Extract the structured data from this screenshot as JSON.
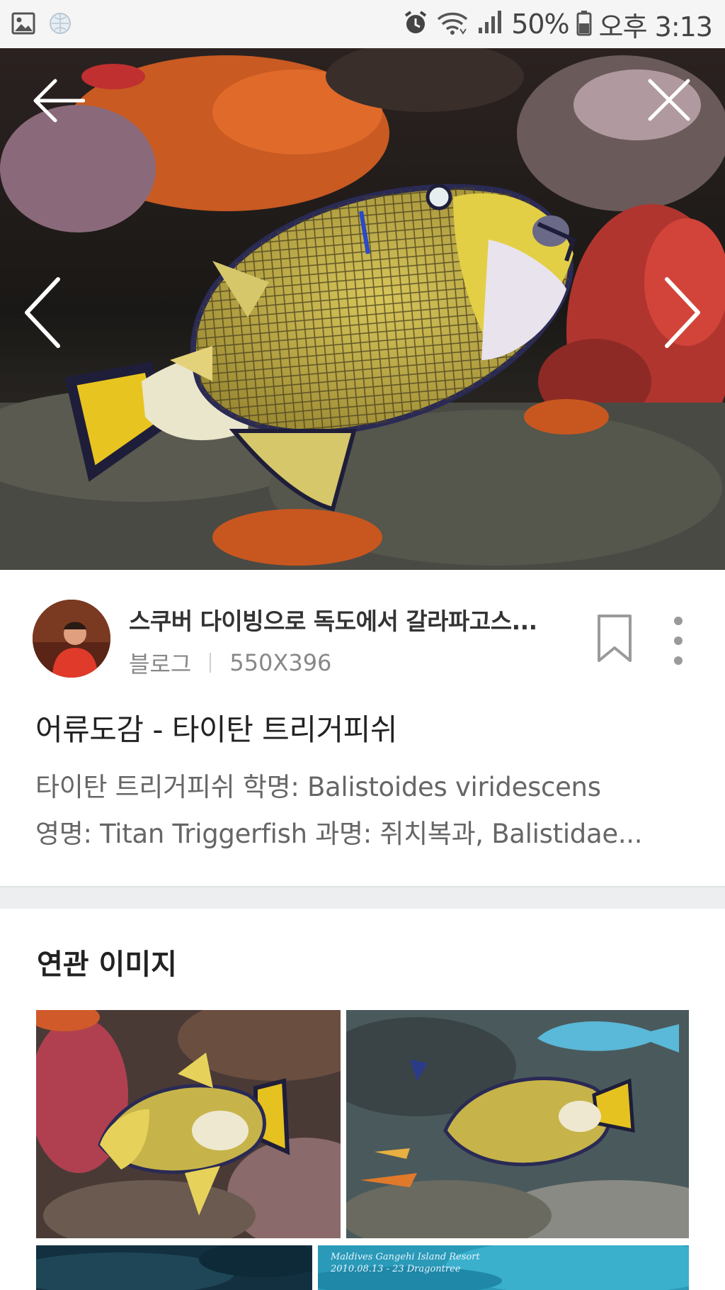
{
  "status_bar": {
    "left_icons": [
      "gallery-icon",
      "globe-icon"
    ],
    "right_icons": [
      "alarm-icon",
      "wifi-icon",
      "signal-icon",
      "battery-icon"
    ],
    "battery": "50%",
    "time": "오후 3:13"
  },
  "viewer": {
    "icons": [
      "back-arrow-icon",
      "close-icon",
      "chevron-left-icon",
      "chevron-right-icon"
    ]
  },
  "source": {
    "title": "스쿠버 다이빙으로 독도에서 갈라파고스...",
    "type": "블로그",
    "dimensions": "550X396",
    "icons": [
      "bookmark-icon",
      "more-vertical-icon"
    ]
  },
  "image_title": "어류도감 - 타이탄 트리거피쉬",
  "description": {
    "line1": "타이탄 트리거피쉬 학명: Balistoides viridescens",
    "line2": "영명: Titan Triggerfish 과명: 쥐치복과, Balistidae..."
  },
  "related": {
    "heading": "연관 이미지",
    "thumb4_text_line1": "Maldives Gangehi Island Resort",
    "thumb4_text_line2": "2010.08.13 - 23      Dragontree"
  },
  "colors": {
    "background": "#ffffff",
    "status_bar": "#f5f5f5",
    "divider": "#eceef0",
    "secondary_text": "#888888"
  }
}
